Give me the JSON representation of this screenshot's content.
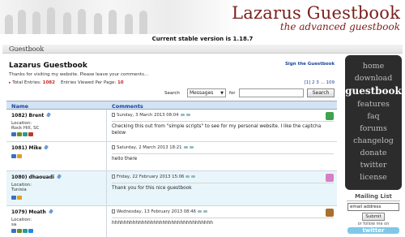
{
  "header": {
    "title": "Lazarus Guestbook",
    "subtitle": "the advanced guestbook"
  },
  "version_text": "Current stable version is 1.18.7",
  "section_tab": "Guestbook",
  "guestbook": {
    "title": "Lazarus Guestbook",
    "sign_link": "Sign the Guestbook",
    "thanks": "Thanks for visiting my website. Please leave your comments...",
    "total_label": "Total Entries:",
    "total_value": "1082",
    "per_page_label": "Entries Viewed Per Page:",
    "per_page_value": "10",
    "pagination": "[1] 2 3 ... 109"
  },
  "search": {
    "label": "Search",
    "field": "Messages",
    "for_label": "for",
    "query": "",
    "button": "Search"
  },
  "table": {
    "col_name": "Name",
    "col_comments": "Comments",
    "rows": [
      {
        "name": "1082) Brent",
        "location_label": "Location:",
        "location": "Rock Hill, SC",
        "date": "Sunday, 3 March 2013 08:04",
        "comment": "Checking this out from \"simple scripts\" to see for my personal website. I like the captcha below",
        "avatar_color": "#3fa34d"
      },
      {
        "name": "1081) Mike",
        "location_label": "",
        "location": "",
        "date": "Saturday, 2 March 2013 18:21",
        "comment": "hello there",
        "avatar_color": ""
      },
      {
        "name": "1080) dhaouadi",
        "location_label": "Location:",
        "location": "Tunisia",
        "date": "Friday, 22 February 2013 15:06",
        "comment": "Thank you for this nice guestbook",
        "avatar_color": "#d77fc4"
      },
      {
        "name": "1079) Moath",
        "location_label": "Location:",
        "location": "sa",
        "date": "Wednesday, 13 February 2013 08:46",
        "comment": "hhhhhhhhhhhhhhhhhhhhhhhhhhhhhhhhhh",
        "avatar_color": "#a8702e"
      }
    ]
  },
  "nav": {
    "items": [
      "home",
      "download",
      "guestbook",
      "features",
      "faq",
      "forums",
      "changelog",
      "donate",
      "twitter",
      "license"
    ],
    "active": "guestbook"
  },
  "mailing": {
    "title": "Mailing List",
    "email_value": "email address",
    "submit": "Submit",
    "follow_text": "or follow me on",
    "twitter_badge": "twitter"
  },
  "colors": {
    "brand": "#7a1f1c",
    "link": "#1a3f9c",
    "accent_red": "#c62828",
    "nav_bg": "#2c2c2c",
    "row_alt": "#e8f6fb"
  }
}
